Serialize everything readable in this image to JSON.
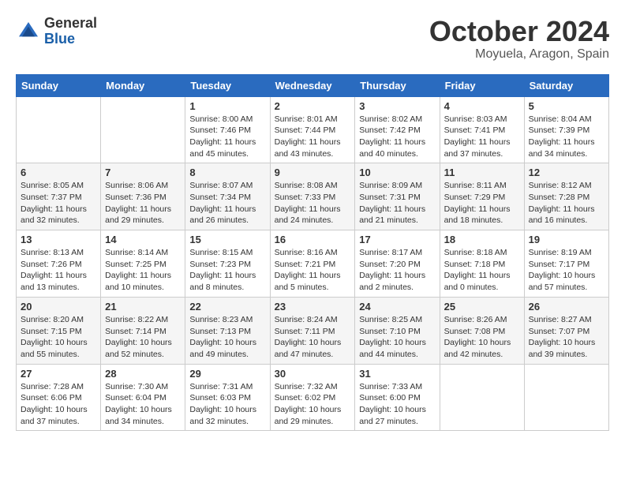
{
  "logo": {
    "general": "General",
    "blue": "Blue"
  },
  "title": {
    "month": "October 2024",
    "location": "Moyuela, Aragon, Spain"
  },
  "headers": [
    "Sunday",
    "Monday",
    "Tuesday",
    "Wednesday",
    "Thursday",
    "Friday",
    "Saturday"
  ],
  "weeks": [
    [
      {
        "day": "",
        "info": ""
      },
      {
        "day": "",
        "info": ""
      },
      {
        "day": "1",
        "info": "Sunrise: 8:00 AM\nSunset: 7:46 PM\nDaylight: 11 hours and 45 minutes."
      },
      {
        "day": "2",
        "info": "Sunrise: 8:01 AM\nSunset: 7:44 PM\nDaylight: 11 hours and 43 minutes."
      },
      {
        "day": "3",
        "info": "Sunrise: 8:02 AM\nSunset: 7:42 PM\nDaylight: 11 hours and 40 minutes."
      },
      {
        "day": "4",
        "info": "Sunrise: 8:03 AM\nSunset: 7:41 PM\nDaylight: 11 hours and 37 minutes."
      },
      {
        "day": "5",
        "info": "Sunrise: 8:04 AM\nSunset: 7:39 PM\nDaylight: 11 hours and 34 minutes."
      }
    ],
    [
      {
        "day": "6",
        "info": "Sunrise: 8:05 AM\nSunset: 7:37 PM\nDaylight: 11 hours and 32 minutes."
      },
      {
        "day": "7",
        "info": "Sunrise: 8:06 AM\nSunset: 7:36 PM\nDaylight: 11 hours and 29 minutes."
      },
      {
        "day": "8",
        "info": "Sunrise: 8:07 AM\nSunset: 7:34 PM\nDaylight: 11 hours and 26 minutes."
      },
      {
        "day": "9",
        "info": "Sunrise: 8:08 AM\nSunset: 7:33 PM\nDaylight: 11 hours and 24 minutes."
      },
      {
        "day": "10",
        "info": "Sunrise: 8:09 AM\nSunset: 7:31 PM\nDaylight: 11 hours and 21 minutes."
      },
      {
        "day": "11",
        "info": "Sunrise: 8:11 AM\nSunset: 7:29 PM\nDaylight: 11 hours and 18 minutes."
      },
      {
        "day": "12",
        "info": "Sunrise: 8:12 AM\nSunset: 7:28 PM\nDaylight: 11 hours and 16 minutes."
      }
    ],
    [
      {
        "day": "13",
        "info": "Sunrise: 8:13 AM\nSunset: 7:26 PM\nDaylight: 11 hours and 13 minutes."
      },
      {
        "day": "14",
        "info": "Sunrise: 8:14 AM\nSunset: 7:25 PM\nDaylight: 11 hours and 10 minutes."
      },
      {
        "day": "15",
        "info": "Sunrise: 8:15 AM\nSunset: 7:23 PM\nDaylight: 11 hours and 8 minutes."
      },
      {
        "day": "16",
        "info": "Sunrise: 8:16 AM\nSunset: 7:21 PM\nDaylight: 11 hours and 5 minutes."
      },
      {
        "day": "17",
        "info": "Sunrise: 8:17 AM\nSunset: 7:20 PM\nDaylight: 11 hours and 2 minutes."
      },
      {
        "day": "18",
        "info": "Sunrise: 8:18 AM\nSunset: 7:18 PM\nDaylight: 11 hours and 0 minutes."
      },
      {
        "day": "19",
        "info": "Sunrise: 8:19 AM\nSunset: 7:17 PM\nDaylight: 10 hours and 57 minutes."
      }
    ],
    [
      {
        "day": "20",
        "info": "Sunrise: 8:20 AM\nSunset: 7:15 PM\nDaylight: 10 hours and 55 minutes."
      },
      {
        "day": "21",
        "info": "Sunrise: 8:22 AM\nSunset: 7:14 PM\nDaylight: 10 hours and 52 minutes."
      },
      {
        "day": "22",
        "info": "Sunrise: 8:23 AM\nSunset: 7:13 PM\nDaylight: 10 hours and 49 minutes."
      },
      {
        "day": "23",
        "info": "Sunrise: 8:24 AM\nSunset: 7:11 PM\nDaylight: 10 hours and 47 minutes."
      },
      {
        "day": "24",
        "info": "Sunrise: 8:25 AM\nSunset: 7:10 PM\nDaylight: 10 hours and 44 minutes."
      },
      {
        "day": "25",
        "info": "Sunrise: 8:26 AM\nSunset: 7:08 PM\nDaylight: 10 hours and 42 minutes."
      },
      {
        "day": "26",
        "info": "Sunrise: 8:27 AM\nSunset: 7:07 PM\nDaylight: 10 hours and 39 minutes."
      }
    ],
    [
      {
        "day": "27",
        "info": "Sunrise: 7:28 AM\nSunset: 6:06 PM\nDaylight: 10 hours and 37 minutes."
      },
      {
        "day": "28",
        "info": "Sunrise: 7:30 AM\nSunset: 6:04 PM\nDaylight: 10 hours and 34 minutes."
      },
      {
        "day": "29",
        "info": "Sunrise: 7:31 AM\nSunset: 6:03 PM\nDaylight: 10 hours and 32 minutes."
      },
      {
        "day": "30",
        "info": "Sunrise: 7:32 AM\nSunset: 6:02 PM\nDaylight: 10 hours and 29 minutes."
      },
      {
        "day": "31",
        "info": "Sunrise: 7:33 AM\nSunset: 6:00 PM\nDaylight: 10 hours and 27 minutes."
      },
      {
        "day": "",
        "info": ""
      },
      {
        "day": "",
        "info": ""
      }
    ]
  ]
}
